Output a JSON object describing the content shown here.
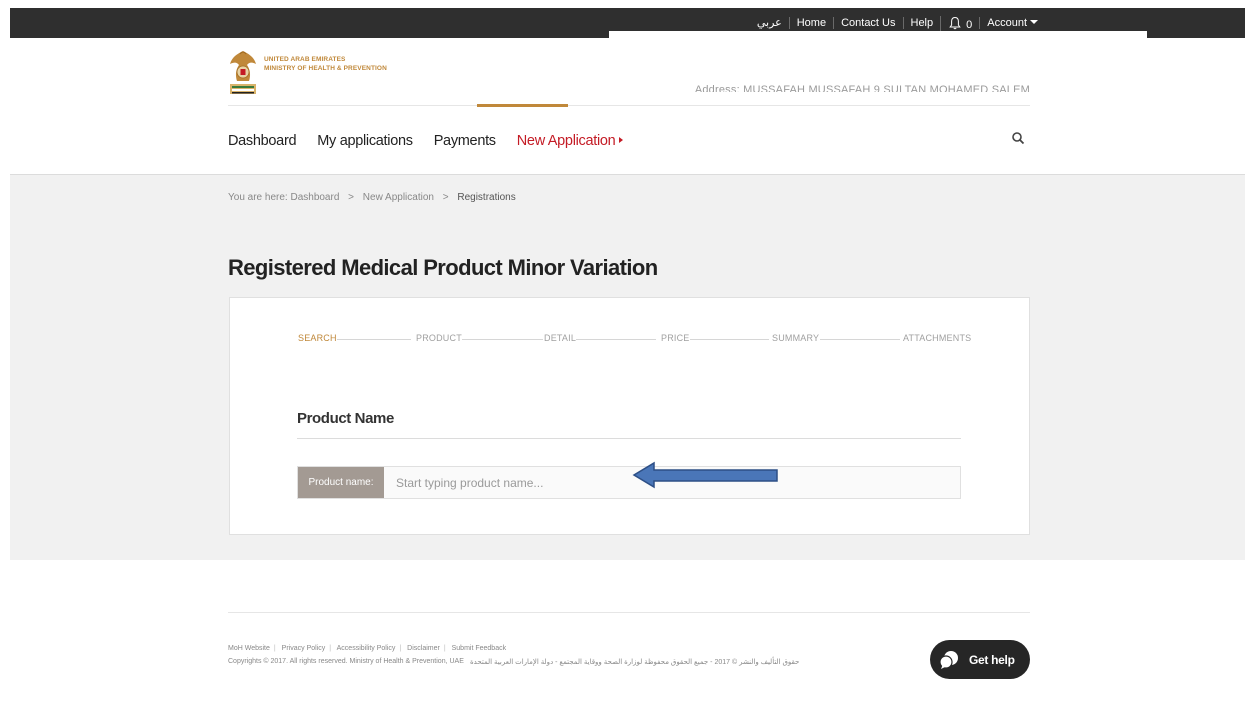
{
  "topbar": {
    "links": [
      "عربي",
      "Home",
      "Contact Us",
      "Help"
    ],
    "notification_count": "0",
    "account_label": "Account"
  },
  "header": {
    "logo_line1": "UNITED ARAB EMIRATES",
    "logo_line2": "MINISTRY OF HEALTH & PREVENTION",
    "address": "Address: MUSSAFAH MUSSAFAH 9 SULTAN MOHAMED SALEM"
  },
  "nav": {
    "items": [
      "Dashboard",
      "My applications",
      "Payments",
      "New Application"
    ]
  },
  "breadcrumb": {
    "prefix": "You are here:",
    "items": [
      "Dashboard",
      "New Application",
      "Registrations"
    ]
  },
  "page": {
    "title": "Registered Medical Product Minor Variation"
  },
  "wizard": {
    "steps": [
      "SEARCH",
      "PRODUCT",
      "DETAIL",
      "PRICE",
      "SUMMARY",
      "ATTACHMENTS"
    ],
    "active_step": "SEARCH"
  },
  "form": {
    "section_title": "Product Name",
    "field_label": "Product name:",
    "field_placeholder": "Start typing product name...",
    "field_value": ""
  },
  "footer": {
    "links": [
      "MoH Website",
      "Privacy Policy",
      "Accessibility Policy",
      "Disclaimer",
      "Submit Feedback"
    ],
    "copyright": "Copyrights © 2017. All rights reserved. Ministry of Health & Prevention, UAE",
    "copyright_ar": "حقوق التأليف والنشر © 2017 - جميع الحقوق محفوظة لوزارة الصحة ووقاية المجتمع - دولة الإمارات العربية المتحدة",
    "get_help": "Get help"
  },
  "colors": {
    "accent_gold": "#c0883a",
    "active_red": "#c41b25",
    "topbar_bg": "#2f2f2f",
    "annotation_arrow": "#4a76b8"
  }
}
